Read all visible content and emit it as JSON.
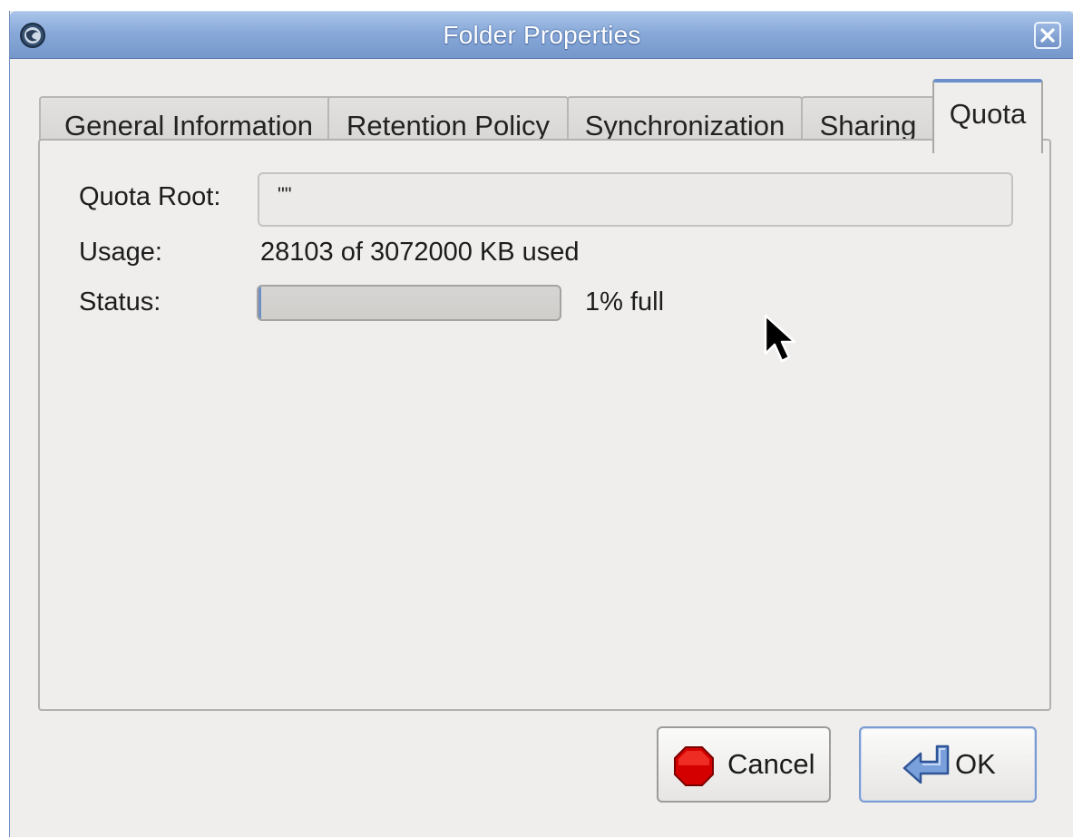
{
  "window": {
    "title": "Folder Properties"
  },
  "tabs": [
    {
      "label": "General Information",
      "active": false
    },
    {
      "label": "Retention Policy",
      "active": false
    },
    {
      "label": "Synchronization",
      "active": false
    },
    {
      "label": "Sharing",
      "active": false
    },
    {
      "label": "Quota",
      "active": true
    }
  ],
  "quota": {
    "root_label": "Quota Root:",
    "root_value": "\"\"",
    "usage_label": "Usage:",
    "usage_value": "28103 of 3072000 KB used",
    "status_label": "Status:",
    "status_text": "1% full",
    "progress_fraction": 0.01
  },
  "buttons": {
    "cancel_label": "Cancel",
    "ok_label": "OK"
  },
  "icons": {
    "app": "thunderbird-icon",
    "close": "close-icon",
    "cancel": "stop-icon",
    "ok": "return-arrow-icon",
    "cursor": "mouse-pointer-icon"
  },
  "colors": {
    "titlebar": "#88a9d8",
    "active_tab_accent": "#6a8fcb",
    "stop_red": "#e00000",
    "ok_arrow": "#6d93d4"
  }
}
